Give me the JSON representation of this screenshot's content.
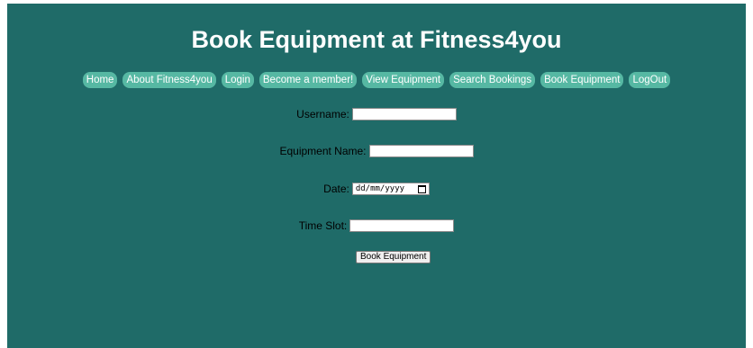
{
  "page": {
    "title": "Book Equipment at Fitness4you"
  },
  "nav": {
    "items": [
      {
        "label": "Home"
      },
      {
        "label": "About Fitness4you"
      },
      {
        "label": "Login"
      },
      {
        "label": "Become a member!"
      },
      {
        "label": "View Equipment"
      },
      {
        "label": "Search Bookings"
      },
      {
        "label": "Book Equipment"
      },
      {
        "label": "LogOut"
      }
    ]
  },
  "form": {
    "username_label": "Username:",
    "username_value": "",
    "equipment_label": "Equipment Name:",
    "equipment_value": "",
    "date_label": "Date:",
    "date_placeholder": "dd/mm/yyyy",
    "timeslot_label": "Time Slot:",
    "timeslot_value": "",
    "submit_label": "Book Equipment"
  },
  "colors": {
    "background": "#1f6b68",
    "nav_button": "#56b8a3",
    "title_text": "#ffffff"
  },
  "icons": {
    "date_picker": "calendar-icon"
  }
}
